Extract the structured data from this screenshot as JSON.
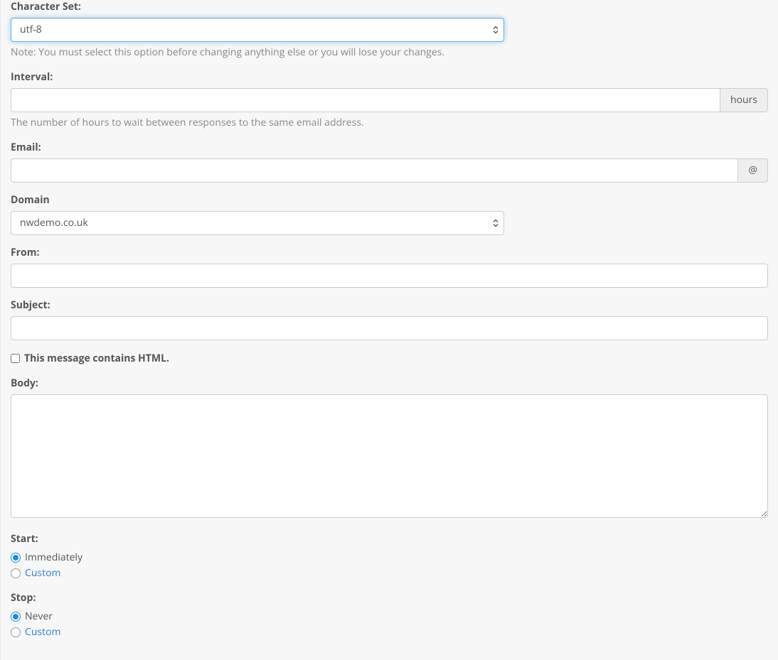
{
  "characterSet": {
    "label": "Character Set:",
    "value": "utf-8",
    "help": "Note: You must select this option before changing anything else or you will lose your changes."
  },
  "interval": {
    "label": "Interval:",
    "value": "",
    "addon": "hours",
    "help": "The number of hours to wait between responses to the same email address."
  },
  "email": {
    "label": "Email:",
    "value": "",
    "addon": "@"
  },
  "domain": {
    "label": "Domain",
    "value": "nwdemo.co.uk"
  },
  "from": {
    "label": "From:",
    "value": ""
  },
  "subject": {
    "label": "Subject:",
    "value": ""
  },
  "htmlCheckbox": {
    "label": "This message contains HTML.",
    "checked": false
  },
  "body": {
    "label": "Body:",
    "value": ""
  },
  "start": {
    "label": "Start:",
    "options": {
      "immediately": "Immediately",
      "custom": "Custom"
    },
    "selected": "immediately"
  },
  "stop": {
    "label": "Stop:",
    "options": {
      "never": "Never",
      "custom": "Custom"
    },
    "selected": "never"
  }
}
